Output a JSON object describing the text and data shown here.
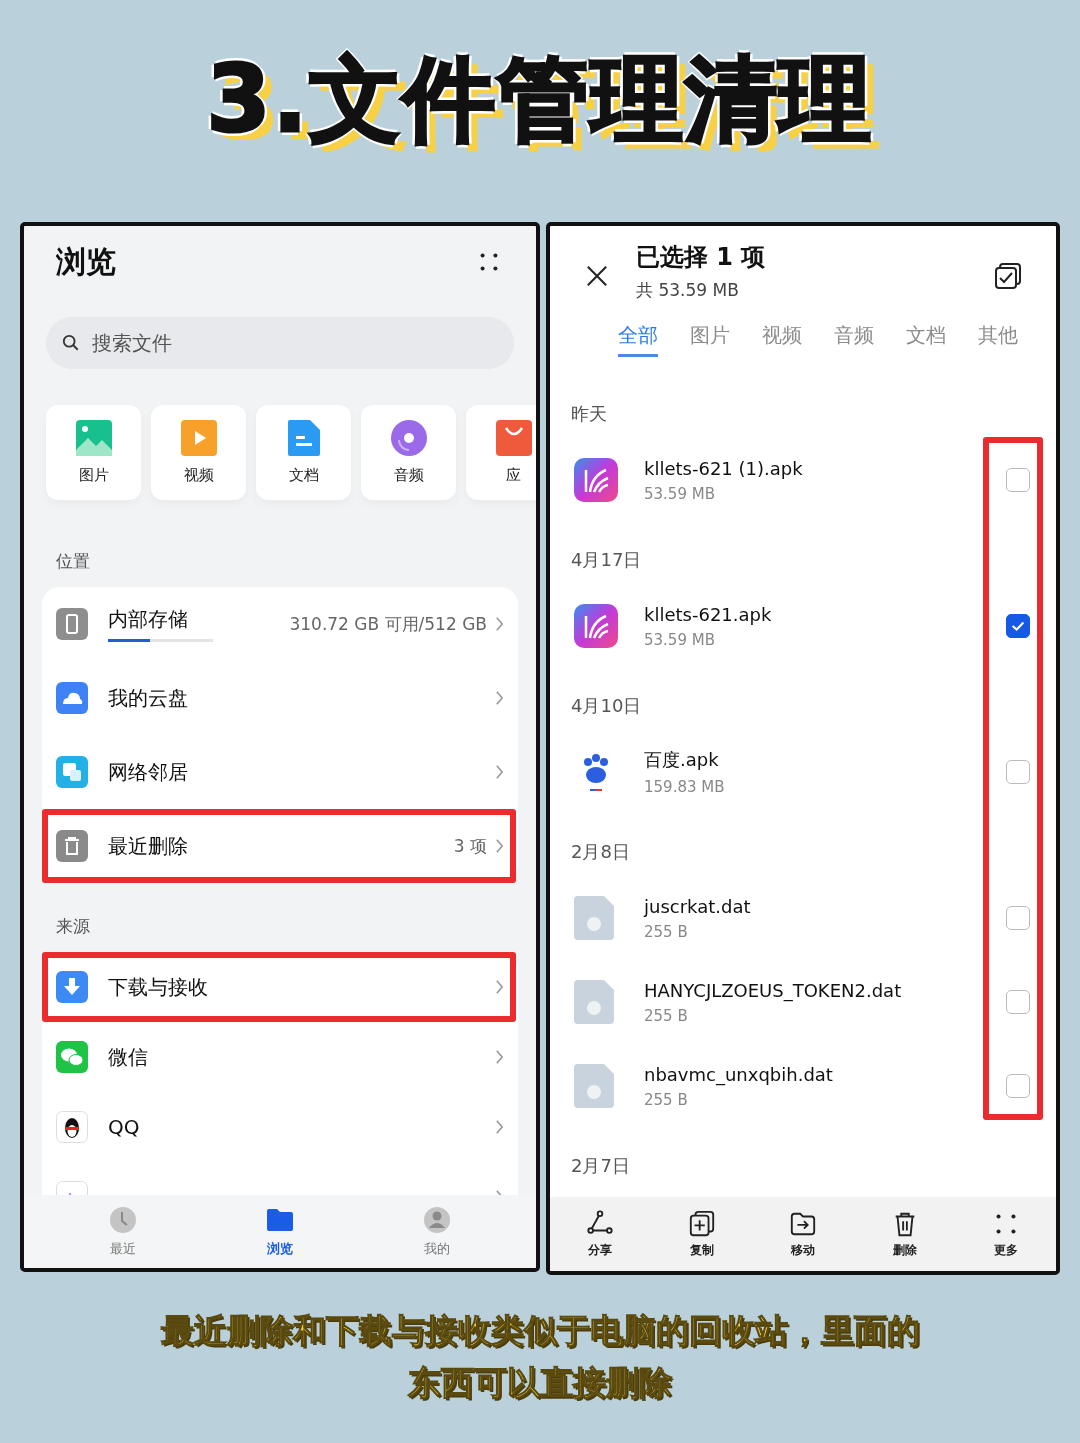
{
  "title": "3.文件管理清理",
  "left_screen": {
    "header": "浏览",
    "search": {
      "placeholder": "搜索文件"
    },
    "categories": [
      {
        "label": "图片",
        "kind": "image"
      },
      {
        "label": "视频",
        "kind": "video"
      },
      {
        "label": "文档",
        "kind": "doc"
      },
      {
        "label": "音频",
        "kind": "audio"
      },
      {
        "label": "应",
        "kind": "app"
      }
    ],
    "sections": [
      {
        "title": "位置",
        "items": [
          {
            "label": "内部存储",
            "kind": "storage",
            "detail": "310.72 GB 可用/512 GB",
            "level": 0.4,
            "highlighted": false
          },
          {
            "label": "我的云盘",
            "kind": "cloud",
            "highlighted": false
          },
          {
            "label": "网络邻居",
            "kind": "network",
            "highlighted": false
          },
          {
            "label": "最近删除",
            "kind": "trash",
            "detail": "3 项",
            "highlighted": true
          }
        ]
      },
      {
        "title": "来源",
        "items": [
          {
            "label": "下载与接收",
            "kind": "download",
            "highlighted": true
          },
          {
            "label": "微信",
            "kind": "chat",
            "highlighted": false
          },
          {
            "label": "QQ",
            "kind": "penguin",
            "highlighted": false
          },
          {
            "kind": "recorder",
            "highlighted": false
          }
        ]
      }
    ],
    "nav": [
      {
        "label": "最近",
        "kind": "clock",
        "selected": false
      },
      {
        "label": "浏览",
        "kind": "folder",
        "selected": true
      },
      {
        "label": "我的",
        "kind": "person",
        "selected": false
      }
    ]
  },
  "right_screen": {
    "title": "已选择 1 项",
    "subtitle": "共 53.59 MB",
    "tabs": [
      {
        "label": "全部",
        "selected": true
      },
      {
        "label": "图片",
        "selected": false
      },
      {
        "label": "视频",
        "selected": false
      },
      {
        "label": "音频",
        "selected": false
      },
      {
        "label": "文档",
        "selected": false
      },
      {
        "label": "其他",
        "selected": false
      }
    ],
    "groups": [
      {
        "date": "昨天",
        "files": [
          {
            "name": "kllets-621 (1).apk",
            "size": "53.59 MB",
            "kind": "app",
            "checked": false
          }
        ]
      },
      {
        "date": "4月17日",
        "files": [
          {
            "name": "kllets-621.apk",
            "size": "53.59 MB",
            "kind": "app",
            "checked": true
          }
        ]
      },
      {
        "date": "4月10日",
        "files": [
          {
            "name": "百度.apk",
            "size": "159.83 MB",
            "kind": "paw",
            "checked": false
          }
        ]
      },
      {
        "date": "2月8日",
        "files": [
          {
            "name": "juscrkat.dat",
            "size": "255 B",
            "kind": "unknown",
            "checked": false
          },
          {
            "name": "HANYCJLZOEUS_TOKEN2.dat",
            "size": "255 B",
            "kind": "unknown",
            "checked": false
          },
          {
            "name": "nbavmc_unxqbih.dat",
            "size": "255 B",
            "kind": "unknown",
            "checked": false
          }
        ]
      },
      {
        "date": "2月7日"
      }
    ],
    "checkboxes_highlighted": true,
    "toolbar": [
      {
        "label": "分享",
        "kind": "share"
      },
      {
        "label": "复制",
        "kind": "copy"
      },
      {
        "label": "移动",
        "kind": "move"
      },
      {
        "label": "删除",
        "kind": "delete"
      },
      {
        "label": "更多",
        "kind": "more"
      }
    ]
  },
  "caption": "最近删除和下载与接收类似于电脑的回收站，里面的东西可以直接删除"
}
